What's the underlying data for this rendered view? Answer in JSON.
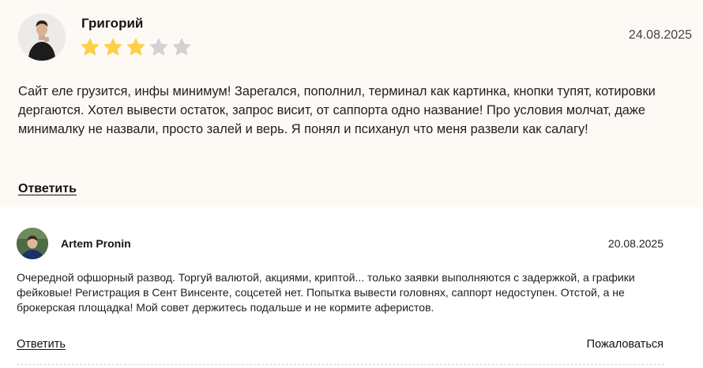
{
  "review_1": {
    "author": "Григорий",
    "date": "24.08.2025",
    "rating": 3,
    "rating_max": 5,
    "star_color_filled": "#fdd046",
    "star_color_empty": "#d2d2d2",
    "text": "Сайт еле грузится, инфы минимум! Зарегался, пополнил, терминал как картинка, кнопки тупят, котировки дергаются. Хотел вывести остаток, запрос висит, от саппорта одно название! Про условия молчат, даже минималку не назвали, просто залей и верь. Я понял и психанул что меня развели как салагу!",
    "reply_label": "Ответить"
  },
  "review_2": {
    "author": "Artem Pronin",
    "date": "20.08.2025",
    "text": "Очередной офшорный развод. Торгуй валютой, акциями, криптой... только заявки выполняются с задержкой, а графики фейковые! Регистрация в Сент Винсенте, соцсетей нет. Попытка вывести головнях, саппорт недоступен. Отстой, а не брокерская площадка! Мой совет держитесь подальше и не кормите аферистов.",
    "reply_label": "Ответить",
    "complain_label": "Пожаловаться"
  },
  "colors": {
    "review_1_background": "#fdfaf6",
    "review_2_background": "#ffffff"
  }
}
